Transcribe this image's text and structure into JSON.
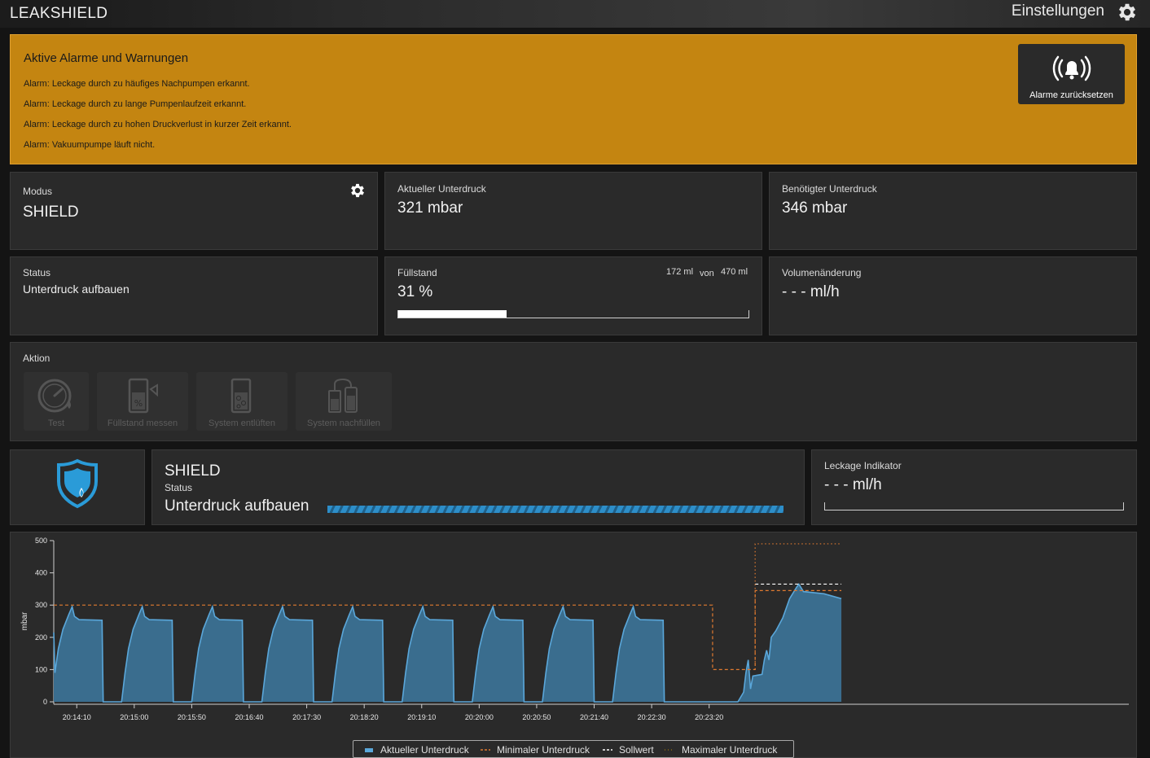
{
  "header": {
    "title": "LEAKSHIELD",
    "settings_label": "Einstellungen",
    "settings_icon": "gear-icon"
  },
  "alarms": {
    "title": "Aktive Alarme und Warnungen",
    "items": [
      "Alarm: Leckage durch zu häufiges Nachpumpen erkannt.",
      "Alarm: Leckage durch zu lange Pumpenlaufzeit erkannt.",
      "Alarm: Leckage durch zu hohen Druckverlust in kurzer Zeit erkannt.",
      "Alarm: Vakuumpumpe läuft nicht."
    ],
    "reset_button": "Alarme zurücksetzen",
    "reset_icon": "alarm-bell-icon",
    "background_color": "#c48511"
  },
  "modus": {
    "label": "Modus",
    "value": "SHIELD",
    "icon": "gear-icon"
  },
  "current_pressure": {
    "label": "Aktueller Unterdruck",
    "value": "321 mbar"
  },
  "required_pressure": {
    "label": "Benötigter Unterdruck",
    "value": "346 mbar"
  },
  "status": {
    "label": "Status",
    "value": "Unterdruck aufbauen"
  },
  "fill_level": {
    "label": "Füllstand",
    "value": "31 %",
    "amount": "172 ml",
    "of_label": "von",
    "capacity": "470 ml",
    "fraction": 0.31
  },
  "volume_change": {
    "label": "Volumenänderung",
    "value": "- - - ml/h"
  },
  "action": {
    "label": "Aktion",
    "buttons": [
      {
        "label": "Test",
        "icon": "gauge-icon"
      },
      {
        "label": "Füllstand messen",
        "icon": "fill-measure-icon"
      },
      {
        "label": "System entlüften",
        "icon": "vent-icon"
      },
      {
        "label": "System nachfüllen",
        "icon": "refill-icon"
      }
    ]
  },
  "shield_status": {
    "title": "SHIELD",
    "status_label": "Status",
    "status_value": "Unterdruck aufbauen",
    "icon": "shield-drop-icon",
    "accent_color": "#2a9bd8"
  },
  "leak_indicator": {
    "label": "Leckage Indikator",
    "value": "- - - ml/h"
  },
  "chart_data": {
    "type": "area",
    "ylabel": "mbar",
    "ylim": [
      0,
      500
    ],
    "y_ticks": [
      0,
      100,
      200,
      300,
      400,
      500
    ],
    "x_ticks": [
      "20:14:10",
      "20:15:00",
      "20:15:50",
      "20:16:40",
      "20:17:30",
      "20:18:20",
      "20:19:10",
      "20:20:00",
      "20:20:50",
      "20:21:40",
      "20:22:30",
      "20:23:20"
    ],
    "x_range_seconds": [
      -20,
      915
    ],
    "grid": false,
    "legend": "bottom-center",
    "series": [
      {
        "name": "Aktueller Unterdruck",
        "color": "#5aa7da",
        "kind": "area",
        "cycle": {
          "period": 61,
          "points": [
            [
              0,
              0
            ],
            [
              3,
              90
            ],
            [
              6,
              165
            ],
            [
              10,
              225
            ],
            [
              15,
              270
            ],
            [
              18,
              295
            ],
            [
              20,
              265
            ],
            [
              24,
              255
            ],
            [
              44,
              253
            ],
            [
              45,
              0
            ],
            [
              54,
              0
            ],
            [
              61,
              0
            ]
          ]
        },
        "first_cycle_start": -22,
        "cycle_count": 9,
        "tail": [
          [
            542,
            0
          ],
          [
            575,
            0
          ],
          [
            580,
            30
          ],
          [
            582,
            90
          ],
          [
            584,
            130
          ],
          [
            586,
            40
          ],
          [
            588,
            80
          ],
          [
            596,
            85
          ],
          [
            598,
            130
          ],
          [
            600,
            160
          ],
          [
            602,
            130
          ],
          [
            604,
            200
          ],
          [
            608,
            220
          ],
          [
            614,
            260
          ],
          [
            620,
            320
          ],
          [
            626,
            355
          ],
          [
            628,
            365
          ],
          [
            632,
            342
          ],
          [
            650,
            335
          ],
          [
            665,
            320
          ]
        ]
      },
      {
        "name": "Minimaler Unterdruck",
        "color": "#e07a30",
        "kind": "dashed",
        "points": [
          [
            -20,
            300
          ],
          [
            553,
            300
          ],
          [
            553,
            100
          ],
          [
            570,
            100
          ],
          [
            570,
            100
          ],
          [
            590,
            100
          ],
          [
            590,
            345
          ],
          [
            665,
            345
          ]
        ]
      },
      {
        "name": "Sollwert",
        "color": "#ffffff",
        "kind": "dashed",
        "points": [
          [
            590,
            365
          ],
          [
            665,
            365
          ]
        ]
      },
      {
        "name": "Maximaler Unterdruck",
        "color": "#e07a30",
        "kind": "dotted",
        "points": [
          [
            590,
            100
          ],
          [
            590,
            490
          ],
          [
            665,
            490
          ]
        ]
      }
    ]
  }
}
